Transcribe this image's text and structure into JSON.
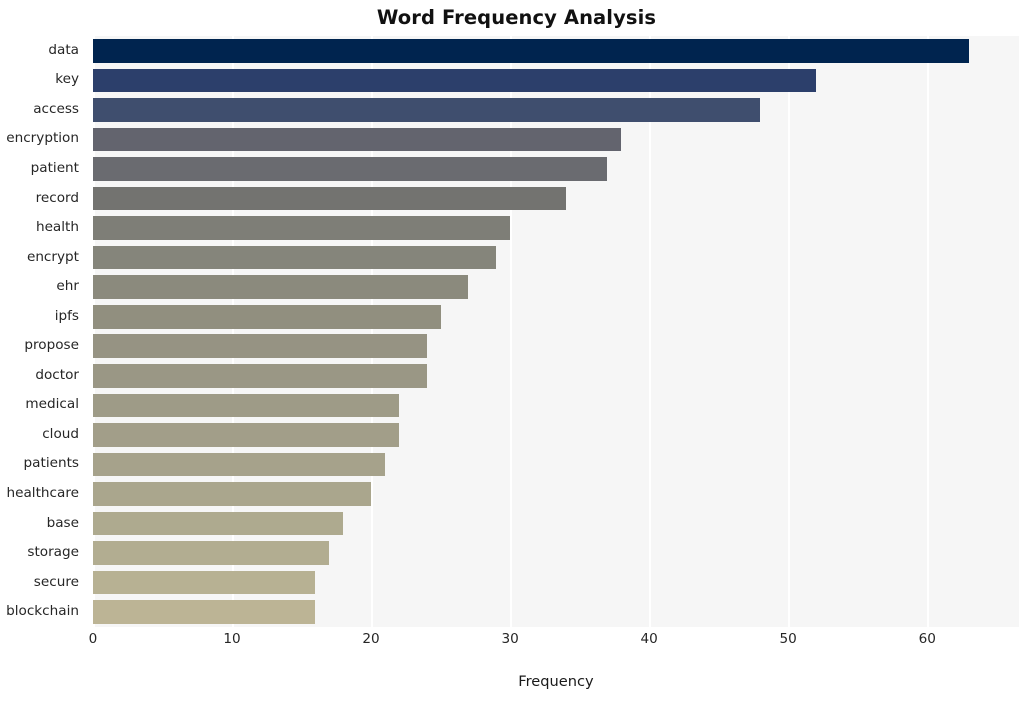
{
  "chart_data": {
    "type": "bar",
    "orientation": "horizontal",
    "title": "Word Frequency Analysis",
    "xlabel": "Frequency",
    "ylabel": "",
    "categories": [
      "data",
      "key",
      "access",
      "encryption",
      "patient",
      "record",
      "health",
      "encrypt",
      "ehr",
      "ipfs",
      "propose",
      "doctor",
      "medical",
      "cloud",
      "patients",
      "healthcare",
      "base",
      "storage",
      "secure",
      "blockchain"
    ],
    "values": [
      63,
      52,
      48,
      38,
      37,
      34,
      30,
      29,
      27,
      25,
      24,
      24,
      22,
      22,
      21,
      20,
      18,
      17,
      16,
      16
    ],
    "bar_colors": [
      "#00244f",
      "#2c3f6b",
      "#3f4e6e",
      "#63646e",
      "#6a6b70",
      "#737370",
      "#7e7e77",
      "#85857b",
      "#8b8a7d",
      "#918f7f",
      "#969383",
      "#9a9785",
      "#9e9b87",
      "#a29e89",
      "#a6a28b",
      "#aaa68d",
      "#aeaa8f",
      "#b2ad91",
      "#b7b193",
      "#bcb495"
    ],
    "xticks": [
      0,
      10,
      20,
      30,
      40,
      50,
      60
    ],
    "xtick_labels": [
      "0",
      "10",
      "20",
      "30",
      "40",
      "50",
      "60"
    ],
    "xlim": [
      0,
      66.6
    ],
    "grid": "vertical-white",
    "legend": "none",
    "plot_background": "#f6f6f6",
    "figure_background": "#ffffff"
  }
}
